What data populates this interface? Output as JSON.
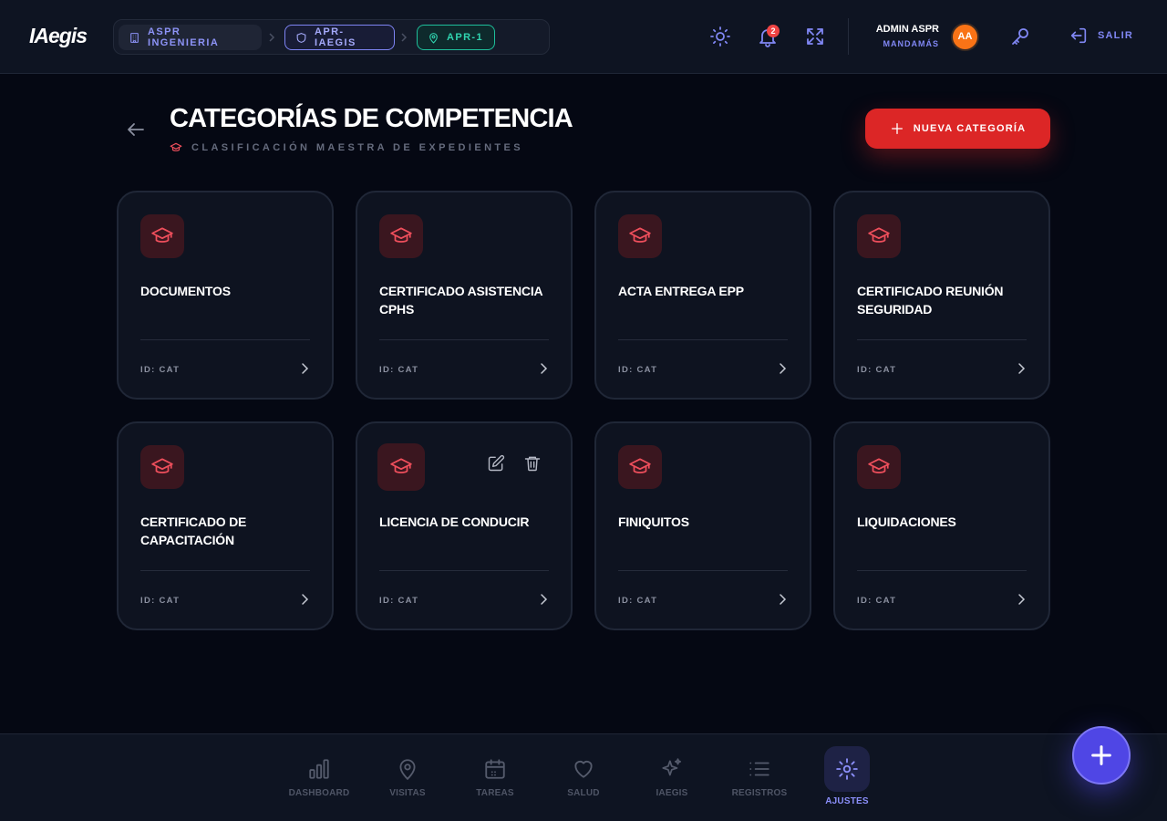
{
  "app": {
    "logo": "IAegis"
  },
  "breadcrumb": [
    {
      "label": "ASPR INGENIERIA",
      "icon": "building-icon"
    },
    {
      "label": "APR-IAEGIS",
      "icon": "shield-icon"
    },
    {
      "label": "APR-1",
      "icon": "map-pin-icon"
    }
  ],
  "header": {
    "notifications_count": "2",
    "user_name": "ADMIN ASPR",
    "user_role": "MANDAMÁS",
    "avatar_initials": "AA",
    "logout_label": "SALIR",
    "icons": [
      "sun-icon",
      "bell-icon",
      "fullscreen-icon",
      "key-icon",
      "logout-icon"
    ]
  },
  "page": {
    "title": "CATEGORÍAS DE COMPETENCIA",
    "subtitle": "CLASIFICACIÓN MAESTRA DE EXPEDIENTES",
    "new_button": "NUEVA CATEGORÍA"
  },
  "categories": [
    {
      "title": "DOCUMENTOS",
      "id_label": "ID: CAT"
    },
    {
      "title": "CERTIFICADO ASISTENCIA CPHS",
      "id_label": "ID: CAT"
    },
    {
      "title": "ACTA ENTREGA EPP",
      "id_label": "ID: CAT"
    },
    {
      "title": "CERTIFICADO REUNIÓN SEGURIDAD",
      "id_label": "ID: CAT"
    },
    {
      "title": "CERTIFICADO DE CAPACITACIÓN",
      "id_label": "ID: CAT"
    },
    {
      "title": "LICENCIA DE CONDUCIR",
      "id_label": "ID: CAT",
      "hovered": true
    },
    {
      "title": "FINIQUITOS",
      "id_label": "ID: CAT"
    },
    {
      "title": "LIQUIDACIONES",
      "id_label": "ID: CAT"
    }
  ],
  "bottom_nav": [
    {
      "label": "DASHBOARD",
      "icon": "bar-chart-icon"
    },
    {
      "label": "VISITAS",
      "icon": "map-pin-icon"
    },
    {
      "label": "TAREAS",
      "icon": "calendar-icon"
    },
    {
      "label": "SALUD",
      "icon": "heart-icon"
    },
    {
      "label": "IAEGIS",
      "icon": "sparkles-icon"
    },
    {
      "label": "REGISTROS",
      "icon": "list-icon"
    },
    {
      "label": "AJUSTES",
      "icon": "settings-icon",
      "active": true
    }
  ],
  "colors": {
    "background": "#050813",
    "surface": "#0e1422",
    "card": "#0e1320",
    "accent": "#8087f4",
    "danger": "#dc2626",
    "icon_red": "#ef4f5c",
    "teal": "#30d5b0",
    "fab": "#4f46e5"
  }
}
